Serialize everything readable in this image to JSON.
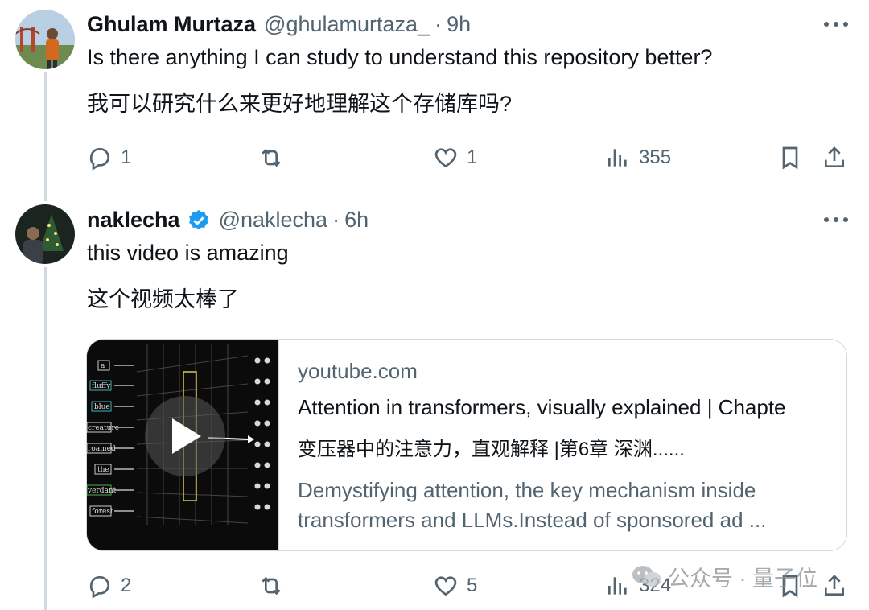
{
  "tweets": [
    {
      "name": "Ghulam Murtaza",
      "handle": "@ghulamurtaza_",
      "sep": "·",
      "time": "9h",
      "text_en": "Is there anything I can study to understand this repository better?",
      "text_cn": "我可以研究什么来更好地理解这个存储库吗?",
      "replies": "1",
      "reposts": "",
      "likes": "1",
      "views": "355"
    },
    {
      "name": "naklecha",
      "handle": "@naklecha",
      "sep": "·",
      "time": "6h",
      "verified": true,
      "text_en": "this video is amazing",
      "text_cn": "这个视频太棒了",
      "replies": "2",
      "reposts": "",
      "likes": "5",
      "views": "324"
    }
  ],
  "card": {
    "domain": "youtube.com",
    "title": "Attention in transformers, visually explained | Chapte",
    "title_cn": "变压器中的注意力，直观解释 |第6章 深渊......",
    "description": "Demystifying attention, the key mechanism inside transformers and LLMs.Instead of sponsored ad ...",
    "thumb_words": [
      "a",
      "fluffy",
      "blue",
      "creature",
      "roamed",
      "the",
      "verdant",
      "forest"
    ]
  },
  "watermark": "公众号 · 量子位",
  "colors": {
    "text": "#0f1419",
    "muted": "#536471",
    "border": "#cfd9de",
    "verified": "#1d9bf0"
  },
  "icons": [
    "reply-icon",
    "repost-icon",
    "like-icon",
    "views-icon",
    "bookmark-icon",
    "share-icon",
    "more-icon",
    "verified-icon",
    "play-icon"
  ]
}
